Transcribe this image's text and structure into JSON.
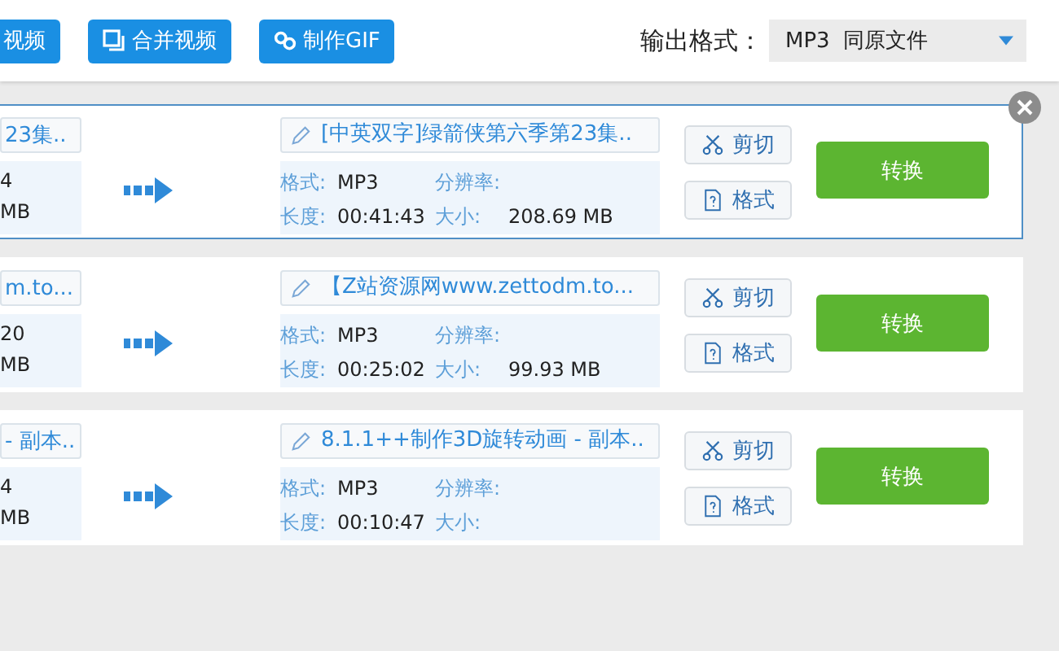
{
  "toolbar": {
    "buttons": [
      {
        "label": "视频",
        "kind": "plain"
      },
      {
        "label": "合并视频",
        "kind": "merge"
      },
      {
        "label": "制作GIF",
        "kind": "gif"
      }
    ],
    "output_format": {
      "label": "输出格式：",
      "value": "MP3  同原文件"
    }
  },
  "items": [
    {
      "selected": true,
      "source_name": "23集..",
      "source_lines": [
        "4",
        "MB"
      ],
      "output_name": "[中英双字]绿箭侠第六季第23集..",
      "fields": [
        {
          "label": "格式:",
          "value": "MP3"
        },
        {
          "label": "分辨率:"
        },
        {
          "label": "长度:",
          "value": "00:41:43"
        },
        {
          "label": "大小:",
          "value": "208.69 MB"
        }
      ],
      "cut_label": "剪切",
      "format_label": "格式",
      "convert_label": "转换"
    },
    {
      "selected": false,
      "source_name": "m.to...",
      "source_lines": [
        "20",
        "MB"
      ],
      "output_name": "【Z站资源网www.zettodm.to...",
      "fields": [
        {
          "label": "格式:",
          "value": "MP3"
        },
        {
          "label": "分辨率:"
        },
        {
          "label": "长度:",
          "value": "00:25:02"
        },
        {
          "label": "大小:",
          "value": "99.93 MB"
        }
      ],
      "cut_label": "剪切",
      "format_label": "格式",
      "convert_label": "转换"
    },
    {
      "selected": false,
      "source_name": "- 副本..",
      "source_lines": [
        "4",
        "MB"
      ],
      "output_name": "8.1.1++制作3D旋转动画 - 副本..",
      "fields": [
        {
          "label": "格式:",
          "value": "MP3"
        },
        {
          "label": "分辨率:"
        },
        {
          "label": "长度:",
          "value": "00:10:47"
        },
        {
          "label": "大小:"
        }
      ],
      "cut_label": "剪切",
      "format_label": "格式",
      "convert_label": "转换"
    }
  ]
}
